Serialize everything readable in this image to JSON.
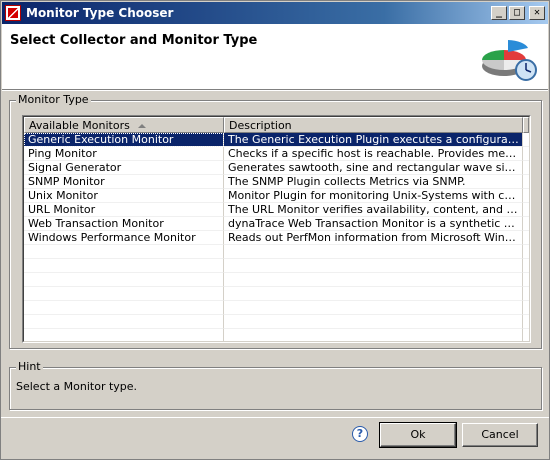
{
  "window": {
    "title": "Monitor Type Chooser",
    "accent": "#0a246a"
  },
  "titlebar_buttons": {
    "minimize": "_",
    "maximize": "□",
    "close": "✕"
  },
  "banner": {
    "title": "Select Collector and Monitor Type",
    "image_icon": "pie-chart-clock-icon"
  },
  "monitor_group": {
    "legend": "Monitor Type",
    "columns": [
      "Available Monitors",
      "Description"
    ],
    "sort_icon": "sort-ascending-icon",
    "rows": [
      {
        "name": "Generic Execution Monitor",
        "description": "The Generic Execution Plugin executes a configurable co...",
        "selected": true
      },
      {
        "name": "Ping Monitor",
        "description": "Checks if a specific host is reachable. Provides measures ..."
      },
      {
        "name": "Signal Generator",
        "description": "Generates sawtooth, sine and rectangular wave signals ..."
      },
      {
        "name": "SNMP Monitor",
        "description": "The SNMP Plugin collects Metrics via SNMP."
      },
      {
        "name": "Unix Monitor",
        "description": "Monitor Plugin for monitoring Unix-Systems with common ..."
      },
      {
        "name": "URL Monitor",
        "description": "The URL Monitor verifies availability, content, and access..."
      },
      {
        "name": "Web Transaction Monitor",
        "description": "dynaTrace Web Transaction Monitor is a synthetic Web T..."
      },
      {
        "name": "Windows Performance Monitor",
        "description": "Reads out PerfMon information from Microsoft Windows S..."
      }
    ]
  },
  "hint_group": {
    "legend": "Hint",
    "text": "Select a Monitor type."
  },
  "buttons": {
    "help": "?",
    "ok": "Ok",
    "cancel": "Cancel"
  }
}
